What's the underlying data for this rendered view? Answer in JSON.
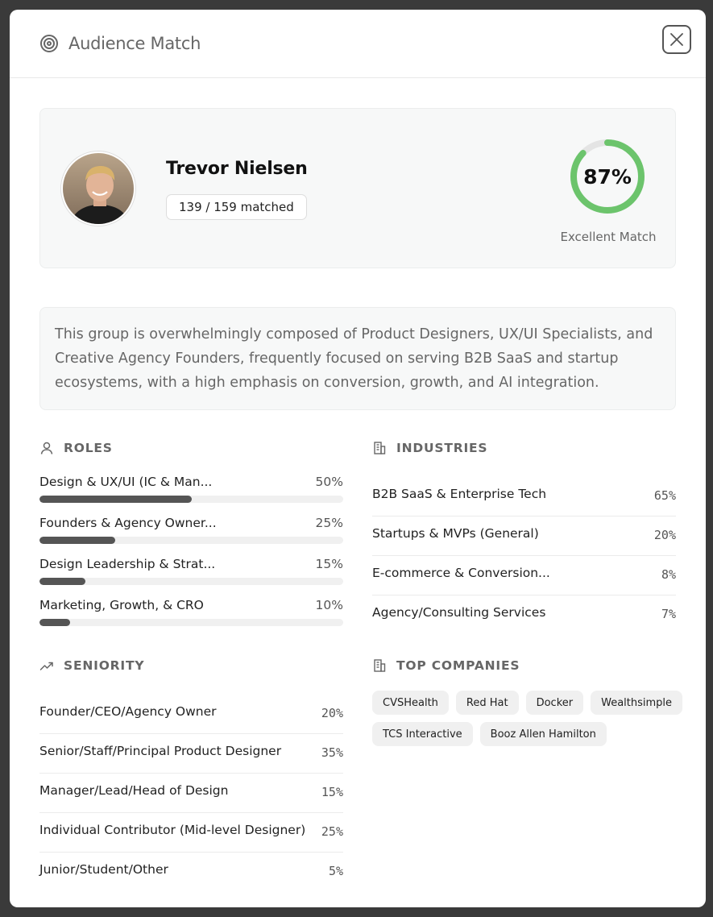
{
  "header": {
    "title": "Audience Match",
    "icon": "target-icon"
  },
  "profile": {
    "name": "Trevor Nielsen",
    "matched_text": "139 / 159 matched",
    "score_text": "87%",
    "score_fraction": 0.87,
    "score_label": "Excellent Match",
    "accent_color": "#6cc46c"
  },
  "summary": "This group is overwhelmingly composed of Product Designers, UX/UI Specialists, and Creative Agency Founders, frequently focused on serving B2B SaaS and startup ecosystems, with a high emphasis on conversion, growth, and AI integration.",
  "roles": {
    "title": "ROLES",
    "items": [
      {
        "label": "Design & UX/UI (IC & Man...",
        "pct": "50%",
        "value": 50
      },
      {
        "label": "Founders & Agency Owner...",
        "pct": "25%",
        "value": 25
      },
      {
        "label": "Design Leadership & Strat...",
        "pct": "15%",
        "value": 15
      },
      {
        "label": "Marketing, Growth, & CRO",
        "pct": "10%",
        "value": 10
      }
    ]
  },
  "industries": {
    "title": "INDUSTRIES",
    "items": [
      {
        "label": "B2B SaaS & Enterprise Tech",
        "pct": "65%"
      },
      {
        "label": "Startups & MVPs (General)",
        "pct": "20%"
      },
      {
        "label": "E-commerce & Conversion...",
        "pct": "8%"
      },
      {
        "label": "Agency/Consulting Services",
        "pct": "7%"
      }
    ]
  },
  "seniority": {
    "title": "SENIORITY",
    "items": [
      {
        "label": "Founder/CEO/Agency Owner",
        "pct": "20%"
      },
      {
        "label": "Senior/Staff/Principal Product Designer",
        "pct": "35%"
      },
      {
        "label": "Manager/Lead/Head of Design",
        "pct": "15%"
      },
      {
        "label": "Individual Contributor (Mid-level Designer)",
        "pct": "25%"
      },
      {
        "label": "Junior/Student/Other",
        "pct": "5%"
      }
    ]
  },
  "companies": {
    "title": "TOP COMPANIES",
    "items": [
      "CVSHealth",
      "Red Hat",
      "Docker",
      "Wealthsimple",
      "TCS Interactive",
      "Booz Allen Hamilton"
    ]
  }
}
